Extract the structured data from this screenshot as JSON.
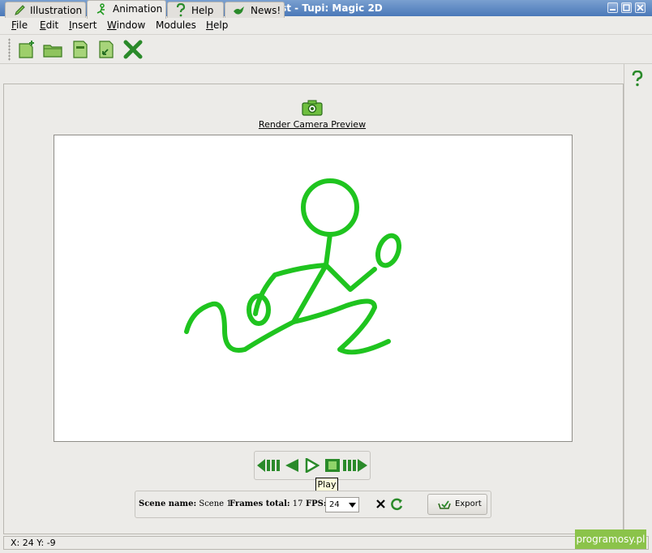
{
  "window": {
    "title": "test - Tupi: Magic 2D"
  },
  "menu": [
    {
      "label": "File",
      "ul": "F",
      "rest": "ile"
    },
    {
      "label": "Edit",
      "ul": "E",
      "rest": "dit"
    },
    {
      "label": "Insert",
      "ul": "I",
      "rest": "nsert"
    },
    {
      "label": "Window",
      "ul": "W",
      "rest": "indow"
    },
    {
      "label": "Modules",
      "ul": "",
      "rest": "Modules"
    },
    {
      "label": "Help",
      "ul": "H",
      "rest": "elp"
    }
  ],
  "tabs": {
    "illustration": "Illustration",
    "animation": "Animation",
    "help": "Help",
    "news": "News!"
  },
  "preview": {
    "render_label": "Render Camera Preview"
  },
  "player": {
    "tooltip": "Play"
  },
  "scene_info": {
    "scene_name_label": "Scene name:",
    "scene_name": "Scene 1",
    "frames_total_label": "Frames total:",
    "frames_total": "17",
    "fps_label": "FPS:",
    "fps": "24",
    "export_label": "Export"
  },
  "status": {
    "coords": "X: 24 Y: -9"
  },
  "watermark": "programosy.pl",
  "colors": {
    "accent": "#2a9a2a",
    "drawing": "#1fc41f",
    "titlebar": "#4a78b8"
  }
}
